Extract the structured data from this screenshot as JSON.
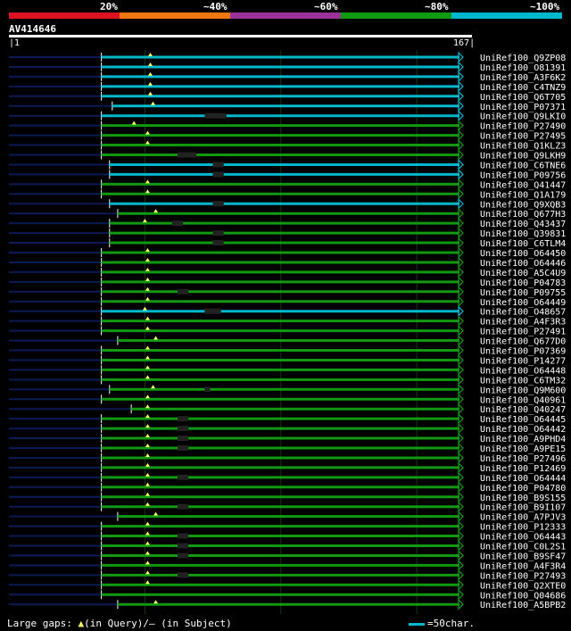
{
  "colors": {
    "background": "#000000",
    "band_colors": [
      "#dd1122",
      "#ee7711",
      "#993399",
      "#119911",
      "#00b8cc"
    ],
    "dark_line": "#0a1a55",
    "tick_line": "#ffffff",
    "gap_mark": "#ffff66",
    "grid": "#0e3a0e"
  },
  "legend": {
    "labels": [
      "20%",
      "~40%",
      "~60%",
      "~80%",
      "~100%"
    ]
  },
  "query": {
    "name": "AV414646",
    "start_label": "1",
    "end_label": "167"
  },
  "footer": {
    "large_gaps_prefix": "Large gaps: ",
    "tri_symbol": "▲",
    "in_query": "(in Query)/",
    "dash": "–",
    "in_subject": " (in Subject)",
    "scale_text": "=50char."
  },
  "chart_data": {
    "type": "alignment",
    "query_length": 167,
    "hits": [
      {
        "name": "UniRef100_Q9ZP08",
        "identity": "~100%",
        "start": 34,
        "end": 167,
        "gap": 40,
        "bump": null
      },
      {
        "name": "UniRef100_O81391",
        "identity": "~100%",
        "start": 34,
        "end": 167,
        "gap": 40,
        "bump": null
      },
      {
        "name": "UniRef100_A3F6K2",
        "identity": "~100%",
        "start": 34,
        "end": 167,
        "gap": 40,
        "bump": null
      },
      {
        "name": "UniRef100_C4TNZ9",
        "identity": "~100%",
        "start": 34,
        "end": 167,
        "gap": 40,
        "bump": null
      },
      {
        "name": "UniRef100_Q6T705",
        "identity": "~100%",
        "start": 34,
        "end": 167,
        "gap": 40,
        "bump": null
      },
      {
        "name": "UniRef100_P07371",
        "identity": "~100%",
        "start": 38,
        "end": 167,
        "gap": 41,
        "bump": null
      },
      {
        "name": "UniRef100_Q9LKI0",
        "identity": "~100%",
        "start": 34,
        "end": 167,
        "gap": null,
        "bump": [
          72,
          80
        ]
      },
      {
        "name": "UniRef100_P27490",
        "identity": "~80%",
        "start": 34,
        "end": 167,
        "gap": 34,
        "bump": null
      },
      {
        "name": "UniRef100_P27495",
        "identity": "~80%",
        "start": 34,
        "end": 167,
        "gap": 39,
        "bump": null
      },
      {
        "name": "UniRef100_Q1KLZ3",
        "identity": "~80%",
        "start": 34,
        "end": 167,
        "gap": 39,
        "bump": null
      },
      {
        "name": "UniRef100_Q9LKH9",
        "identity": "~80%",
        "start": 34,
        "end": 167,
        "gap": null,
        "bump": [
          62,
          69
        ]
      },
      {
        "name": "UniRef100_C6TNE6",
        "identity": "~100%",
        "start": 37,
        "end": 167,
        "gap": null,
        "bump": [
          75,
          79
        ]
      },
      {
        "name": "UniRef100_P09756",
        "identity": "~100%",
        "start": 37,
        "end": 167,
        "gap": null,
        "bump": [
          75,
          79
        ]
      },
      {
        "name": "UniRef100_Q41447",
        "identity": "~80%",
        "start": 34,
        "end": 167,
        "gap": 39,
        "bump": null
      },
      {
        "name": "UniRef100_Q1A179",
        "identity": "~80%",
        "start": 34,
        "end": 167,
        "gap": 39,
        "bump": null
      },
      {
        "name": "UniRef100_Q9XQB3",
        "identity": "~100%",
        "start": 37,
        "end": 167,
        "gap": null,
        "bump": [
          75,
          79
        ]
      },
      {
        "name": "UniRef100_Q677H3",
        "identity": "~80%",
        "start": 40,
        "end": 167,
        "gap": 42,
        "bump": null
      },
      {
        "name": "UniRef100_Q43437",
        "identity": "~80%",
        "start": 37,
        "end": 167,
        "gap": 38,
        "bump": [
          60,
          64
        ]
      },
      {
        "name": "UniRef100_Q39831",
        "identity": "~80%",
        "start": 37,
        "end": 167,
        "gap": null,
        "bump": [
          75,
          79
        ]
      },
      {
        "name": "UniRef100_C6TLM4",
        "identity": "~80%",
        "start": 37,
        "end": 167,
        "gap": null,
        "bump": [
          75,
          79
        ]
      },
      {
        "name": "UniRef100_O64450",
        "identity": "~80%",
        "start": 34,
        "end": 167,
        "gap": 39,
        "bump": null
      },
      {
        "name": "UniRef100_O64446",
        "identity": "~80%",
        "start": 34,
        "end": 167,
        "gap": 39,
        "bump": null
      },
      {
        "name": "UniRef100_A5C4U9",
        "identity": "~80%",
        "start": 34,
        "end": 167,
        "gap": 39,
        "bump": null
      },
      {
        "name": "UniRef100_P04783",
        "identity": "~80%",
        "start": 34,
        "end": 167,
        "gap": 39,
        "bump": null
      },
      {
        "name": "UniRef100_P09755",
        "identity": "~80%",
        "start": 34,
        "end": 167,
        "gap": 39,
        "bump": [
          62,
          66
        ]
      },
      {
        "name": "UniRef100_O64449",
        "identity": "~80%",
        "start": 34,
        "end": 167,
        "gap": 39,
        "bump": null
      },
      {
        "name": "UniRef100_O48657",
        "identity": "~100%",
        "start": 34,
        "end": 167,
        "gap": 38,
        "bump": [
          72,
          78
        ]
      },
      {
        "name": "UniRef100_A4F3R3",
        "identity": "~80%",
        "start": 34,
        "end": 167,
        "gap": 39,
        "bump": null
      },
      {
        "name": "UniRef100_P27491",
        "identity": "~80%",
        "start": 34,
        "end": 167,
        "gap": 39,
        "bump": null
      },
      {
        "name": "UniRef100_Q677D0",
        "identity": "~80%",
        "start": 40,
        "end": 167,
        "gap": 42,
        "bump": null
      },
      {
        "name": "UniRef100_P07369",
        "identity": "~80%",
        "start": 34,
        "end": 167,
        "gap": 39,
        "bump": null
      },
      {
        "name": "UniRef100_P14277",
        "identity": "~80%",
        "start": 34,
        "end": 167,
        "gap": 39,
        "bump": null
      },
      {
        "name": "UniRef100_O64448",
        "identity": "~80%",
        "start": 34,
        "end": 167,
        "gap": 39,
        "bump": null
      },
      {
        "name": "UniRef100_C6TM32",
        "identity": "~80%",
        "start": 34,
        "end": 167,
        "gap": 39,
        "bump": null
      },
      {
        "name": "UniRef100_Q9M600",
        "identity": "~80%",
        "start": 37,
        "end": 167,
        "gap": 41,
        "bump": [
          72,
          74
        ]
      },
      {
        "name": "UniRef100_Q40961",
        "identity": "~80%",
        "start": 34,
        "end": 167,
        "gap": 39,
        "bump": null
      },
      {
        "name": "UniRef100_Q40247",
        "identity": "~80%",
        "start": 45,
        "end": 167,
        "gap": 39,
        "bump": null
      },
      {
        "name": "UniRef100_O64445",
        "identity": "~80%",
        "start": 34,
        "end": 167,
        "gap": 39,
        "bump": [
          62,
          66
        ]
      },
      {
        "name": "UniRef100_O64442",
        "identity": "~80%",
        "start": 34,
        "end": 167,
        "gap": 39,
        "bump": [
          62,
          66
        ]
      },
      {
        "name": "UniRef100_A9PHD4",
        "identity": "~80%",
        "start": 34,
        "end": 167,
        "gap": 39,
        "bump": [
          62,
          66
        ]
      },
      {
        "name": "UniRef100_A9PE15",
        "identity": "~80%",
        "start": 34,
        "end": 167,
        "gap": 39,
        "bump": [
          62,
          66
        ]
      },
      {
        "name": "UniRef100_P27496",
        "identity": "~80%",
        "start": 34,
        "end": 167,
        "gap": 39,
        "bump": null
      },
      {
        "name": "UniRef100_P12469",
        "identity": "~80%",
        "start": 34,
        "end": 167,
        "gap": 39,
        "bump": null
      },
      {
        "name": "UniRef100_O64444",
        "identity": "~80%",
        "start": 34,
        "end": 167,
        "gap": 39,
        "bump": [
          62,
          66
        ]
      },
      {
        "name": "UniRef100_P04780",
        "identity": "~80%",
        "start": 34,
        "end": 167,
        "gap": 39,
        "bump": null
      },
      {
        "name": "UniRef100_B9S155",
        "identity": "~80%",
        "start": 34,
        "end": 167,
        "gap": 39,
        "bump": null
      },
      {
        "name": "UniRef100_B9I107",
        "identity": "~80%",
        "start": 34,
        "end": 167,
        "gap": 39,
        "bump": [
          62,
          66
        ]
      },
      {
        "name": "UniRef100_A7PJV3",
        "identity": "~80%",
        "start": 40,
        "end": 167,
        "gap": 42,
        "bump": null
      },
      {
        "name": "UniRef100_P12333",
        "identity": "~80%",
        "start": 34,
        "end": 167,
        "gap": 39,
        "bump": null
      },
      {
        "name": "UniRef100_O64443",
        "identity": "~80%",
        "start": 34,
        "end": 167,
        "gap": 39,
        "bump": [
          62,
          66
        ]
      },
      {
        "name": "UniRef100_C0L2S1",
        "identity": "~80%",
        "start": 34,
        "end": 167,
        "gap": 39,
        "bump": [
          62,
          66
        ]
      },
      {
        "name": "UniRef100_B9SF47",
        "identity": "~80%",
        "start": 34,
        "end": 167,
        "gap": 39,
        "bump": [
          62,
          66
        ]
      },
      {
        "name": "UniRef100_A4F3R4",
        "identity": "~80%",
        "start": 34,
        "end": 167,
        "gap": 39,
        "bump": null
      },
      {
        "name": "UniRef100_P27493",
        "identity": "~80%",
        "start": 34,
        "end": 167,
        "gap": 39,
        "bump": [
          62,
          66
        ]
      },
      {
        "name": "UniRef100_Q2XTE0",
        "identity": "~80%",
        "start": 34,
        "end": 167,
        "gap": 39,
        "bump": null
      },
      {
        "name": "UniRef100_Q04686",
        "identity": "~80%",
        "start": 34,
        "end": 167,
        "gap": null,
        "bump": null
      },
      {
        "name": "UniRef100_A5BPB2",
        "identity": "~80%",
        "start": 40,
        "end": 167,
        "gap": 42,
        "bump": null
      }
    ]
  }
}
